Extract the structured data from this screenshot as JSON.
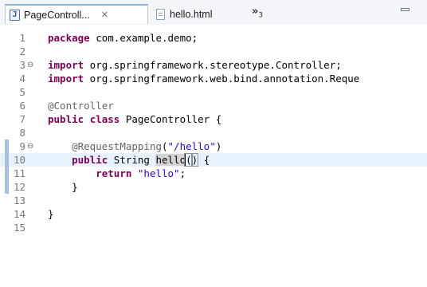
{
  "tabs": [
    {
      "label": "PageControll...",
      "icon": "java-file-icon",
      "close": "✕",
      "active": true
    },
    {
      "label": "hello.html",
      "icon": "html-file-icon",
      "active": false
    }
  ],
  "overflow": {
    "chevron": "»",
    "count": "3"
  },
  "editor": {
    "lines": [
      {
        "num": "1",
        "fold": "",
        "tokens": [
          [
            "kw",
            "package"
          ],
          [
            "t",
            " com.example.demo;"
          ]
        ]
      },
      {
        "num": "2",
        "fold": "",
        "tokens": []
      },
      {
        "num": "3",
        "fold": "⊖",
        "tokens": [
          [
            "kw",
            "import"
          ],
          [
            "t",
            " org.springframework.stereotype.Controller;"
          ]
        ]
      },
      {
        "num": "4",
        "fold": "",
        "tokens": [
          [
            "kw",
            "import"
          ],
          [
            "t",
            " org.springframework.web.bind.annotation.Reque"
          ]
        ]
      },
      {
        "num": "5",
        "fold": "",
        "tokens": []
      },
      {
        "num": "6",
        "fold": "",
        "tokens": [
          [
            "ann",
            "@Controller"
          ]
        ]
      },
      {
        "num": "7",
        "fold": "",
        "tokens": [
          [
            "kw",
            "public"
          ],
          [
            "t",
            " "
          ],
          [
            "kw",
            "class"
          ],
          [
            "t",
            " PageController {"
          ]
        ]
      },
      {
        "num": "8",
        "fold": "",
        "tokens": []
      },
      {
        "num": "9",
        "fold": "⊖",
        "mark": true,
        "tokens": [
          [
            "t",
            "    "
          ],
          [
            "ann",
            "@RequestMapping"
          ],
          [
            "t",
            "("
          ],
          [
            "str",
            "\"/hello\""
          ],
          [
            "t",
            ")"
          ]
        ]
      },
      {
        "num": "10",
        "fold": "",
        "mark": true,
        "current": true,
        "tokens": [
          [
            "t",
            "    "
          ],
          [
            "kw",
            "public"
          ],
          [
            "t",
            " String "
          ],
          [
            "occ",
            "hello"
          ],
          [
            "bracket",
            "("
          ],
          [
            "bracket",
            ")"
          ],
          [
            "t",
            " {"
          ]
        ]
      },
      {
        "num": "11",
        "fold": "",
        "mark": true,
        "tokens": [
          [
            "t",
            "        "
          ],
          [
            "kw",
            "return"
          ],
          [
            "t",
            " "
          ],
          [
            "str",
            "\"hello\""
          ],
          [
            "t",
            ";"
          ]
        ]
      },
      {
        "num": "12",
        "fold": "",
        "mark": true,
        "tokens": [
          [
            "t",
            "    }"
          ]
        ]
      },
      {
        "num": "13",
        "fold": "",
        "tokens": []
      },
      {
        "num": "14",
        "fold": "",
        "tokens": [
          [
            "t",
            "}"
          ]
        ]
      },
      {
        "num": "15",
        "fold": "",
        "tokens": []
      }
    ]
  }
}
